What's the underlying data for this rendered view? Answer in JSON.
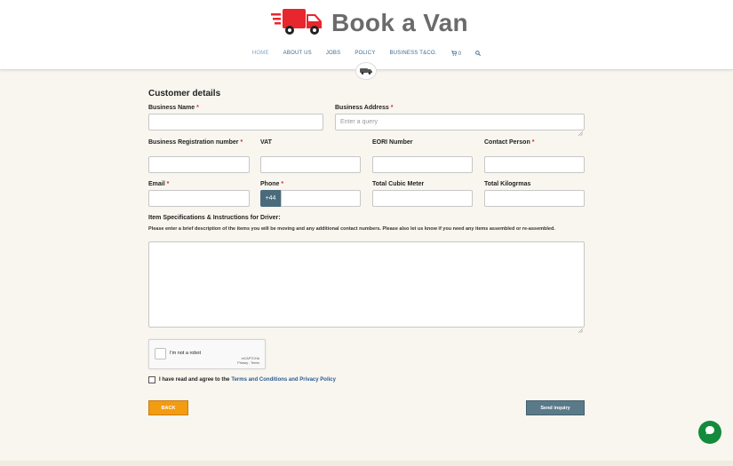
{
  "brand": {
    "name": "Book a Van",
    "accent": "#e8262e"
  },
  "nav": {
    "items": [
      {
        "label": "HOME"
      },
      {
        "label": "ABOUT US"
      },
      {
        "label": "JOBS"
      },
      {
        "label": "POLICY"
      },
      {
        "label": "BUSINESS T&CO."
      },
      {
        "label": "0"
      }
    ]
  },
  "form": {
    "section_title": "Customer details",
    "required_mark": "*",
    "business_name": {
      "label": "Business Name",
      "value": ""
    },
    "business_address": {
      "label": "Business Address",
      "placeholder": "Enter a query"
    },
    "registration": {
      "label": "Business Registration number",
      "value": ""
    },
    "vat": {
      "label": "VAT",
      "value": ""
    },
    "eori": {
      "label": "EORI Number",
      "value": ""
    },
    "contact_person": {
      "label": "Contact Person",
      "value": ""
    },
    "email": {
      "label": "Email",
      "value": ""
    },
    "phone": {
      "label": "Phone",
      "prefix": "+44",
      "value": ""
    },
    "cubic": {
      "label": "Total Cubic Meter",
      "value": ""
    },
    "kilograms": {
      "label": "Total Kilogrmas",
      "value": ""
    },
    "specs": {
      "label": "Item Specifications & Instructions for Driver:",
      "help": "Please enter a brief description of the items you will be moving and any additional contact numbers. Please also let us know if you need any items assembled or re-assembled."
    },
    "captcha": {
      "label": "I'm not a robot",
      "brand": "reCAPTCHA",
      "links": "Privacy - Terms"
    },
    "agree": {
      "text": "I have read and agree to the",
      "link": "Terms and Conditions and Privacy Policy"
    },
    "back_label": "BACK",
    "send_label": "Send inquiry"
  },
  "icons": [
    "truck-logo-icon",
    "cart-icon",
    "search-icon",
    "van-icon",
    "chat-icon"
  ]
}
